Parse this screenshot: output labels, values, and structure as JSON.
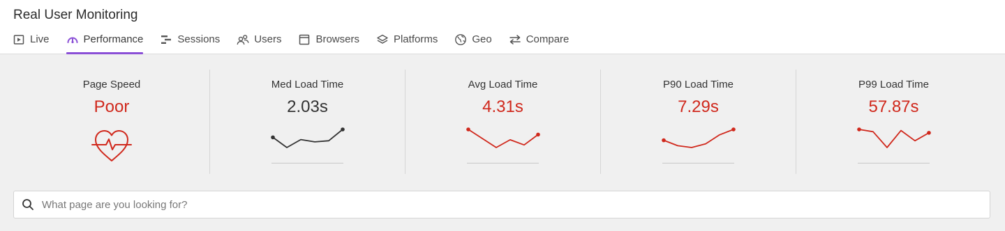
{
  "app": {
    "title": "Real User Monitoring"
  },
  "tabs": [
    {
      "label": "Live",
      "icon": "play-box-icon",
      "active": false
    },
    {
      "label": "Performance",
      "icon": "gauge-icon",
      "active": true
    },
    {
      "label": "Sessions",
      "icon": "sessions-bars-icon",
      "active": false
    },
    {
      "label": "Users",
      "icon": "users-icon",
      "active": false
    },
    {
      "label": "Browsers",
      "icon": "browser-window-icon",
      "active": false
    },
    {
      "label": "Platforms",
      "icon": "layers-icon",
      "active": false
    },
    {
      "label": "Geo",
      "icon": "globe-icon",
      "active": false
    },
    {
      "label": "Compare",
      "icon": "compare-arrows-icon",
      "active": false
    }
  ],
  "colors": {
    "accent": "#8a4fd6",
    "bad": "#d0281c",
    "neutral": "#333333"
  },
  "metrics": [
    {
      "label": "Page Speed",
      "value": "Poor",
      "status": "bad",
      "icon": "heart-pulse-icon"
    },
    {
      "label": "Med Load Time",
      "value": "2.03s",
      "status": "neutral",
      "trend": [
        0.7,
        0.25,
        0.6,
        0.5,
        0.55,
        1.05
      ]
    },
    {
      "label": "Avg Load Time",
      "value": "4.31s",
      "status": "bad",
      "trend": [
        2.9,
        2.55,
        2.2,
        2.5,
        2.3,
        2.7
      ]
    },
    {
      "label": "P90 Load Time",
      "value": "7.29s",
      "status": "bad",
      "trend": [
        6.1,
        5.95,
        5.9,
        6.0,
        6.25,
        6.4
      ]
    },
    {
      "label": "P99 Load Time",
      "value": "57.87s",
      "status": "bad",
      "trend": [
        49,
        48,
        41,
        48.5,
        44,
        47.5
      ]
    }
  ],
  "search": {
    "placeholder": "What page are you looking for?",
    "value": ""
  }
}
